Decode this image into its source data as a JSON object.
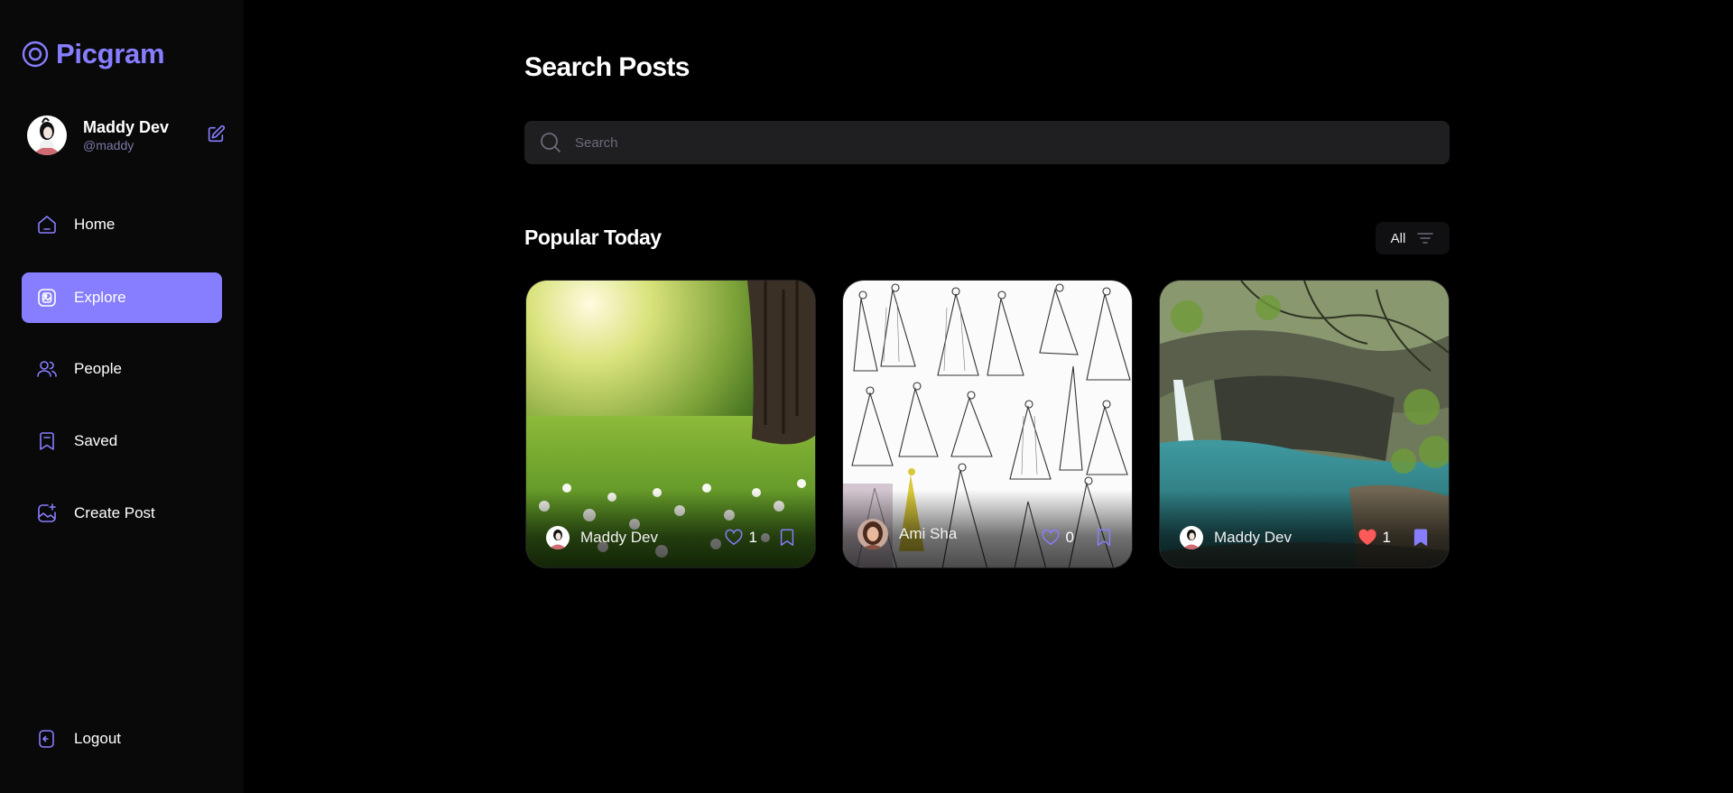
{
  "app": {
    "name": "Picgram",
    "accent": "#877eff",
    "liked_color": "#ff5a5a"
  },
  "user": {
    "name": "Maddy Dev",
    "handle": "@maddy"
  },
  "nav": {
    "home": "Home",
    "explore": "Explore",
    "people": "People",
    "saved": "Saved",
    "create_post": "Create Post",
    "logout": "Logout",
    "active": "explore"
  },
  "page": {
    "title": "Search Posts"
  },
  "search": {
    "placeholder": "Search",
    "value": ""
  },
  "section": {
    "title": "Popular Today"
  },
  "filter": {
    "label": "All"
  },
  "posts": [
    {
      "author": "Maddy Dev",
      "likes": "1",
      "liked": false,
      "saved": false,
      "image": "meadow-with-flowers-and-tree"
    },
    {
      "author": "Ami Sha",
      "likes": "0",
      "liked": false,
      "saved": false,
      "image": "wedding-dress-sketches"
    },
    {
      "author": "Maddy Dev",
      "likes": "1",
      "liked": true,
      "saved": true,
      "image": "waterfall-pool-cave"
    }
  ]
}
